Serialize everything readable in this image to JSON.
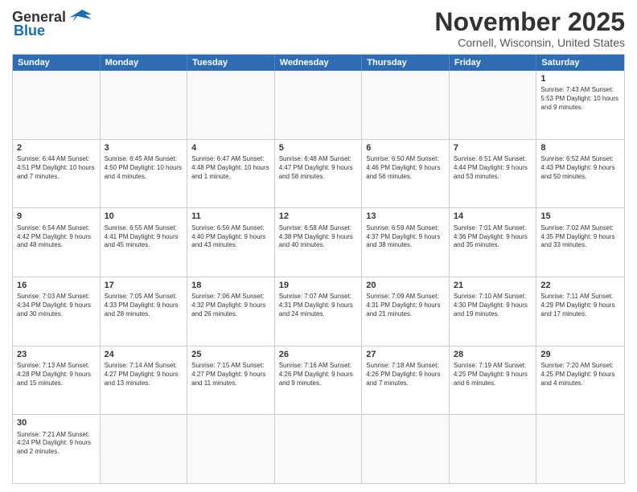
{
  "logo": {
    "text_general": "General",
    "text_blue": "Blue"
  },
  "title": "November 2025",
  "subtitle": "Cornell, Wisconsin, United States",
  "header_days": [
    "Sunday",
    "Monday",
    "Tuesday",
    "Wednesday",
    "Thursday",
    "Friday",
    "Saturday"
  ],
  "weeks": [
    {
      "cells": [
        {
          "day": "",
          "info": ""
        },
        {
          "day": "",
          "info": ""
        },
        {
          "day": "",
          "info": ""
        },
        {
          "day": "",
          "info": ""
        },
        {
          "day": "",
          "info": ""
        },
        {
          "day": "",
          "info": ""
        },
        {
          "day": "1",
          "info": "Sunrise: 7:43 AM\nSunset: 5:53 PM\nDaylight: 10 hours and 9 minutes."
        }
      ]
    },
    {
      "cells": [
        {
          "day": "2",
          "info": "Sunrise: 6:44 AM\nSunset: 4:51 PM\nDaylight: 10 hours and 7 minutes."
        },
        {
          "day": "3",
          "info": "Sunrise: 6:45 AM\nSunset: 4:50 PM\nDaylight: 10 hours and 4 minutes."
        },
        {
          "day": "4",
          "info": "Sunrise: 6:47 AM\nSunset: 4:48 PM\nDaylight: 10 hours and 1 minute."
        },
        {
          "day": "5",
          "info": "Sunrise: 6:48 AM\nSunset: 4:47 PM\nDaylight: 9 hours and 58 minutes."
        },
        {
          "day": "6",
          "info": "Sunrise: 6:50 AM\nSunset: 4:46 PM\nDaylight: 9 hours and 56 minutes."
        },
        {
          "day": "7",
          "info": "Sunrise: 6:51 AM\nSunset: 4:44 PM\nDaylight: 9 hours and 53 minutes."
        },
        {
          "day": "8",
          "info": "Sunrise: 6:52 AM\nSunset: 4:43 PM\nDaylight: 9 hours and 50 minutes."
        }
      ]
    },
    {
      "cells": [
        {
          "day": "9",
          "info": "Sunrise: 6:54 AM\nSunset: 4:42 PM\nDaylight: 9 hours and 48 minutes."
        },
        {
          "day": "10",
          "info": "Sunrise: 6:55 AM\nSunset: 4:41 PM\nDaylight: 9 hours and 45 minutes."
        },
        {
          "day": "11",
          "info": "Sunrise: 6:56 AM\nSunset: 4:40 PM\nDaylight: 9 hours and 43 minutes."
        },
        {
          "day": "12",
          "info": "Sunrise: 6:58 AM\nSunset: 4:38 PM\nDaylight: 9 hours and 40 minutes."
        },
        {
          "day": "13",
          "info": "Sunrise: 6:59 AM\nSunset: 4:37 PM\nDaylight: 9 hours and 38 minutes."
        },
        {
          "day": "14",
          "info": "Sunrise: 7:01 AM\nSunset: 4:36 PM\nDaylight: 9 hours and 35 minutes."
        },
        {
          "day": "15",
          "info": "Sunrise: 7:02 AM\nSunset: 4:35 PM\nDaylight: 9 hours and 33 minutes."
        }
      ]
    },
    {
      "cells": [
        {
          "day": "16",
          "info": "Sunrise: 7:03 AM\nSunset: 4:34 PM\nDaylight: 9 hours and 30 minutes."
        },
        {
          "day": "17",
          "info": "Sunrise: 7:05 AM\nSunset: 4:33 PM\nDaylight: 9 hours and 28 minutes."
        },
        {
          "day": "18",
          "info": "Sunrise: 7:06 AM\nSunset: 4:32 PM\nDaylight: 9 hours and 26 minutes."
        },
        {
          "day": "19",
          "info": "Sunrise: 7:07 AM\nSunset: 4:31 PM\nDaylight: 9 hours and 24 minutes."
        },
        {
          "day": "20",
          "info": "Sunrise: 7:09 AM\nSunset: 4:31 PM\nDaylight: 9 hours and 21 minutes."
        },
        {
          "day": "21",
          "info": "Sunrise: 7:10 AM\nSunset: 4:30 PM\nDaylight: 9 hours and 19 minutes."
        },
        {
          "day": "22",
          "info": "Sunrise: 7:11 AM\nSunset: 4:29 PM\nDaylight: 9 hours and 17 minutes."
        }
      ]
    },
    {
      "cells": [
        {
          "day": "23",
          "info": "Sunrise: 7:13 AM\nSunset: 4:28 PM\nDaylight: 9 hours and 15 minutes."
        },
        {
          "day": "24",
          "info": "Sunrise: 7:14 AM\nSunset: 4:27 PM\nDaylight: 9 hours and 13 minutes."
        },
        {
          "day": "25",
          "info": "Sunrise: 7:15 AM\nSunset: 4:27 PM\nDaylight: 9 hours and 11 minutes."
        },
        {
          "day": "26",
          "info": "Sunrise: 7:16 AM\nSunset: 4:26 PM\nDaylight: 9 hours and 9 minutes."
        },
        {
          "day": "27",
          "info": "Sunrise: 7:18 AM\nSunset: 4:26 PM\nDaylight: 9 hours and 7 minutes."
        },
        {
          "day": "28",
          "info": "Sunrise: 7:19 AM\nSunset: 4:25 PM\nDaylight: 9 hours and 6 minutes."
        },
        {
          "day": "29",
          "info": "Sunrise: 7:20 AM\nSunset: 4:25 PM\nDaylight: 9 hours and 4 minutes."
        }
      ]
    },
    {
      "cells": [
        {
          "day": "30",
          "info": "Sunrise: 7:21 AM\nSunset: 4:24 PM\nDaylight: 9 hours and 2 minutes."
        },
        {
          "day": "",
          "info": ""
        },
        {
          "day": "",
          "info": ""
        },
        {
          "day": "",
          "info": ""
        },
        {
          "day": "",
          "info": ""
        },
        {
          "day": "",
          "info": ""
        },
        {
          "day": "",
          "info": ""
        }
      ]
    }
  ]
}
